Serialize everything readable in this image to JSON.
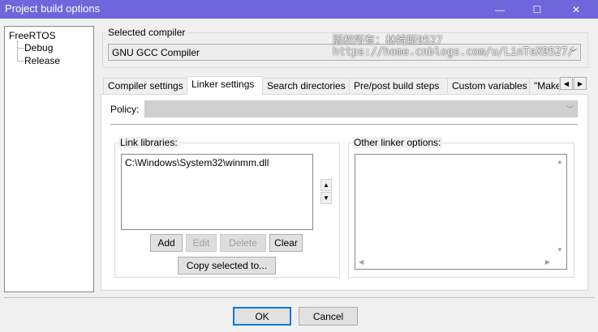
{
  "window": {
    "title": "Project build options",
    "minimize_glyph": "—",
    "maximize_glyph": "☐",
    "close_glyph": "✕"
  },
  "tree": {
    "root": "FreeRTOS",
    "children": [
      "Debug",
      "Release"
    ]
  },
  "compiler": {
    "group_label": "Selected compiler",
    "selected": "GNU GCC Compiler",
    "arrow": "﹀"
  },
  "watermark": {
    "line1": "版权所有：林特斯9527",
    "line2": "https://home.cnblogs.com/u/LinTeX9527/"
  },
  "tabs": [
    {
      "label": "Compiler settings",
      "active": false
    },
    {
      "label": "Linker settings",
      "active": true
    },
    {
      "label": "Search directories",
      "active": false
    },
    {
      "label": "Pre/post build steps",
      "active": false
    },
    {
      "label": "Custom variables",
      "active": false
    },
    {
      "label": "\"Make\"",
      "active": false
    }
  ],
  "tab_scroll": {
    "left": "◀",
    "right": "▶"
  },
  "policy": {
    "label": "Policy:",
    "value": "",
    "arrow": "﹀"
  },
  "link_libraries": {
    "group_label": "Link libraries:",
    "items": [
      "C:\\Windows\\System32\\winmm.dll"
    ],
    "move_up": "▲",
    "move_down": "▼",
    "buttons": {
      "add": "Add",
      "edit": "Edit",
      "delete": "Delete",
      "clear": "Clear",
      "copy": "Copy selected to..."
    }
  },
  "other_linker": {
    "group_label": "Other linker options:",
    "value": "",
    "scroll_up": "▲",
    "scroll_down": "▼",
    "scroll_left": "◀",
    "scroll_right": "▶"
  },
  "footer": {
    "ok": "OK",
    "cancel": "Cancel"
  },
  "colors": {
    "titlebar": "#6f66db",
    "default_button_border": "#0078d7"
  }
}
